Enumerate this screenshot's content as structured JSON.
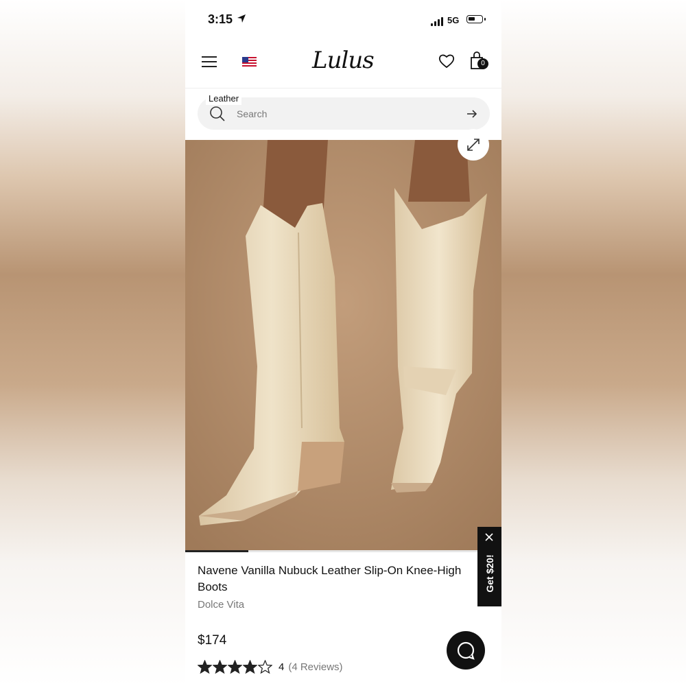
{
  "status_bar": {
    "time": "3:15",
    "network": "5G",
    "battery_level": 0.4
  },
  "header": {
    "logo": "Lulus",
    "cart_count": "0",
    "flag": "us-flag-icon"
  },
  "search": {
    "chip": "Leather",
    "placeholder": "Search"
  },
  "gallery": {
    "progress": 0.2
  },
  "product": {
    "title": "Navene Vanilla Nubuck Leather Slip-On Knee-High Boots",
    "brand": "Dolce Vita",
    "price": "$174",
    "rating": 4,
    "rating_max": 5,
    "rating_text": "4",
    "reviews_text": "(4 Reviews)"
  },
  "promo": {
    "label": "Get $20!"
  },
  "colors": {
    "accent": "#111111",
    "search_bg": "#f2f2f2",
    "muted_text": "#777777",
    "photo_bg": "#b08a68"
  }
}
